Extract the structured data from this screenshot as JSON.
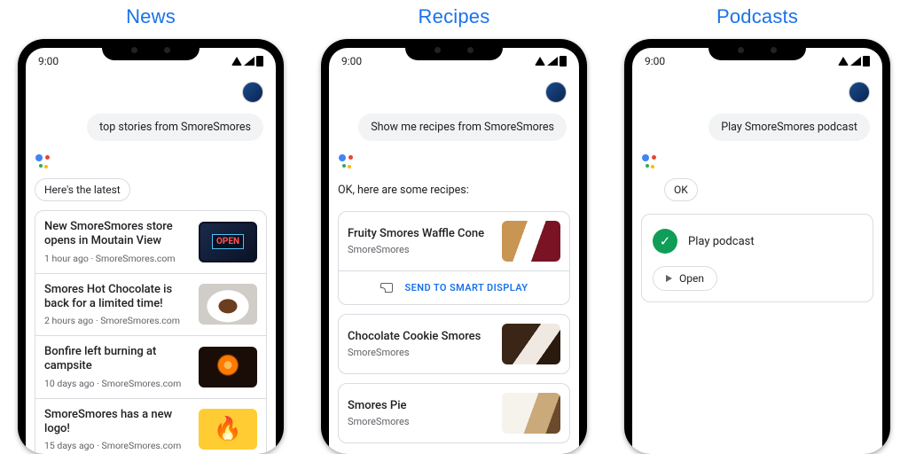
{
  "status_time": "9:00",
  "columns": {
    "news": {
      "header": "News",
      "query": "top stories from SmoreSmores",
      "reply": "Here's the latest",
      "items": [
        {
          "title": "New SmoreSmores store opens in Moutain View",
          "meta": "1 hour ago · SmoreSmores.com",
          "thumb_label": "OPEN"
        },
        {
          "title": "Smores Hot Chocolate is back for a limited time!",
          "meta": "2 hours ago · SmoreSmores.com"
        },
        {
          "title": "Bonfire left burning at campsite",
          "meta": "10 days ago · SmoreSmores.com"
        },
        {
          "title": "SmoreSmores has a new logo!",
          "meta": "15 days ago · SmoreSmores.com"
        }
      ]
    },
    "recipes": {
      "header": "Recipes",
      "query": "Show me recipes from SmoreSmores",
      "reply": "OK, here are some recipes:",
      "send_label": "SEND TO SMART DISPLAY",
      "items": [
        {
          "title": "Fruity Smores Waffle Cone",
          "source": "SmoreSmores"
        },
        {
          "title": "Chocolate Cookie Smores",
          "source": "SmoreSmores"
        },
        {
          "title": "Smores Pie",
          "source": "SmoreSmores"
        }
      ]
    },
    "podcasts": {
      "header": "Podcasts",
      "query": "Play SmoreSmores podcast",
      "reply": "OK",
      "status": "Play podcast",
      "open_label": "Open"
    }
  }
}
